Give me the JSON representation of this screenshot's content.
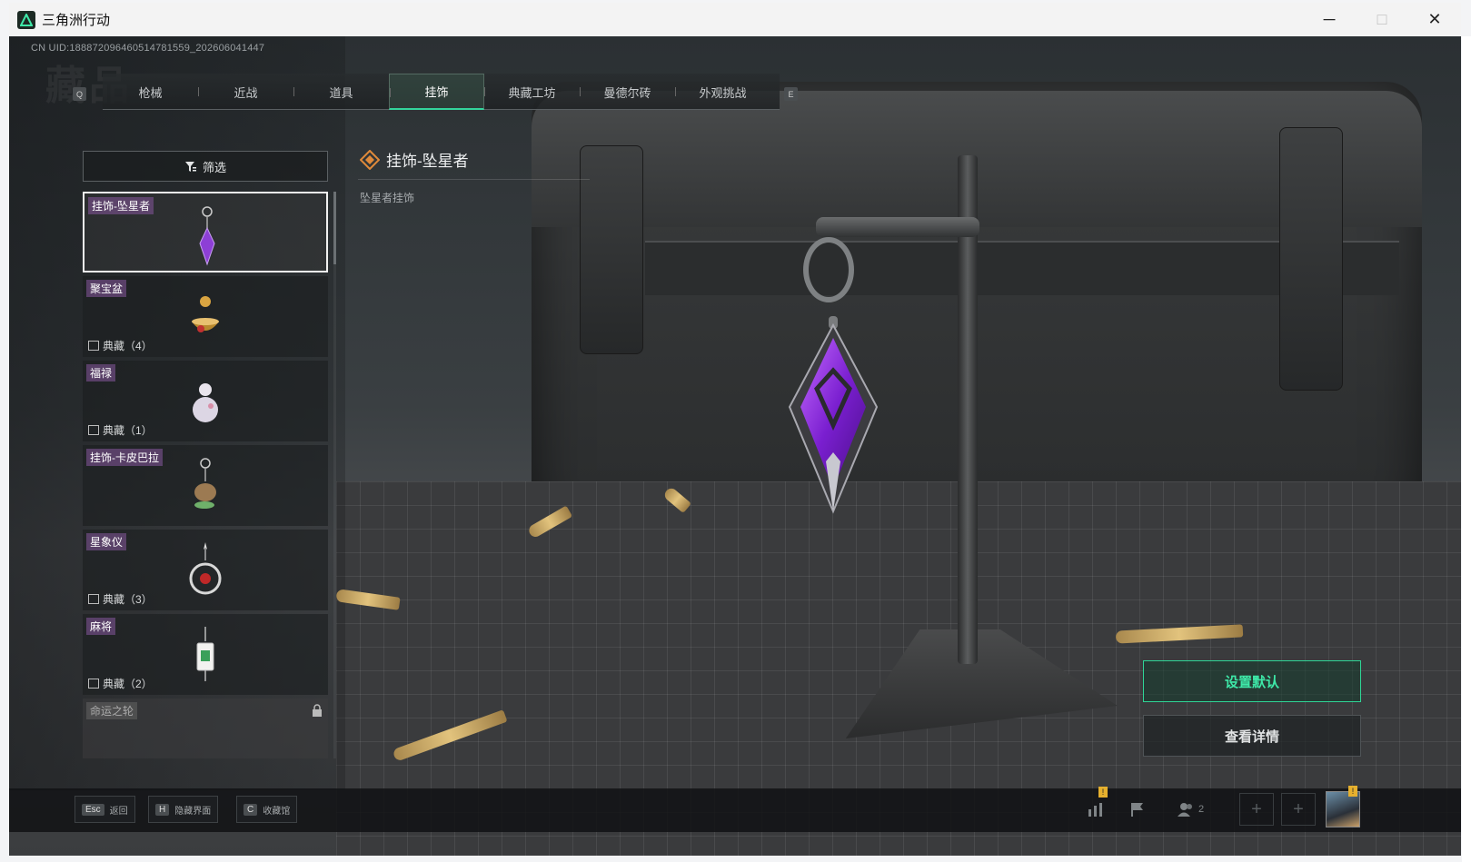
{
  "window": {
    "title": "三角洲行动",
    "minimize": "─",
    "maximize": "□",
    "close": "✕"
  },
  "uid_text": "CN UID:18887209646051478155​9_202606041447",
  "watermark": "藏品",
  "tabs": {
    "prev_key": "Q",
    "next_key": "E",
    "items": [
      {
        "label": "枪械"
      },
      {
        "label": "近战"
      },
      {
        "label": "道具"
      },
      {
        "label": "挂饰",
        "active": true
      },
      {
        "label": "典藏工坊"
      },
      {
        "label": "曼德尔砖"
      },
      {
        "label": "外观挑战"
      }
    ]
  },
  "filter": {
    "label": "筛选",
    "icon": "filter-icon"
  },
  "collection": {
    "items": [
      {
        "name": "挂饰-坠星者",
        "count": "",
        "selected": true
      },
      {
        "name": "聚宝盆",
        "count": "典藏（4）"
      },
      {
        "name": "福禄",
        "count": "典藏（1）"
      },
      {
        "name": "挂饰-卡皮巴拉",
        "count": ""
      },
      {
        "name": "星象仪",
        "count": "典藏（3）"
      },
      {
        "name": "麻将",
        "count": "典藏（2）"
      },
      {
        "name": "命运之轮",
        "count": "",
        "locked": true
      }
    ]
  },
  "detail": {
    "title": "挂饰-坠星者",
    "description": "坠星者挂饰"
  },
  "actions": {
    "set_default": "设置默认",
    "view_details": "查看详情"
  },
  "hints": [
    {
      "key": "Esc",
      "label": "返回"
    },
    {
      "key": "H",
      "label": "隐藏界面"
    },
    {
      "key": "C",
      "label": "收藏馆"
    }
  ],
  "tray": {
    "friends_count": "2",
    "badge": "!"
  },
  "colors": {
    "accent": "#33d49c",
    "label_purple": "#78508c",
    "badge": "#e6b02e"
  }
}
